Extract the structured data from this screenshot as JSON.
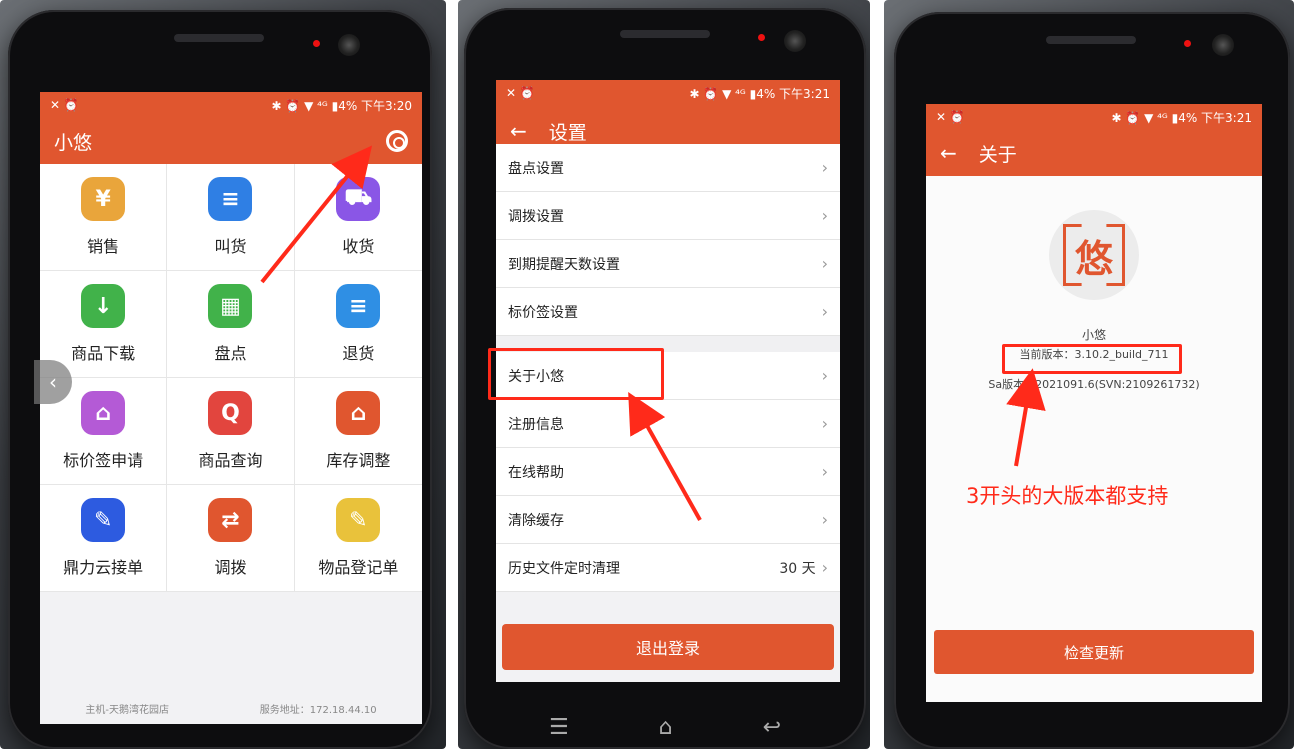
{
  "colors": {
    "accent": "#e0562f",
    "annotation": "#ff2a1a"
  },
  "panel1": {
    "status": {
      "left_icons": "✕ ⏰",
      "right": "✱ ⏰ ▼ ⁴ᴳ ▮4% 下午3:20"
    },
    "app_title": "小悠",
    "settings_icon": "gear-icon",
    "grid": [
      {
        "label": "销售",
        "icon": "sales-icon",
        "color": "#e9a53b",
        "glyph": "¥"
      },
      {
        "label": "叫货",
        "icon": "order-icon",
        "color": "#2f7fe4",
        "glyph": "≡"
      },
      {
        "label": "收货",
        "icon": "receive-truck-icon",
        "color": "#8a56e6",
        "glyph": "⛟"
      },
      {
        "label": "商品下载",
        "icon": "download-icon",
        "color": "#41b24a",
        "glyph": "↓"
      },
      {
        "label": "盘点",
        "icon": "calculator-icon",
        "color": "#41b24a",
        "glyph": "▦"
      },
      {
        "label": "退货",
        "icon": "return-icon",
        "color": "#2f8fe4",
        "glyph": "≡"
      },
      {
        "label": "标价签申请",
        "icon": "price-tag-icon",
        "color": "#b45ad6",
        "glyph": "⌂"
      },
      {
        "label": "商品查询",
        "icon": "search-icon",
        "color": "#e2453e",
        "glyph": "Q"
      },
      {
        "label": "库存调整",
        "icon": "warehouse-icon",
        "color": "#e0562f",
        "glyph": "⌂"
      },
      {
        "label": "鼎力云接单",
        "icon": "cloud-order-icon",
        "color": "#2d5be0",
        "glyph": "✎"
      },
      {
        "label": "调拨",
        "icon": "transfer-icon",
        "color": "#e0562f",
        "glyph": "⇄"
      },
      {
        "label": "物品登记单",
        "icon": "register-icon",
        "color": "#e9c23b",
        "glyph": "✎"
      }
    ],
    "footer_left": "主机-天鹅湾花园店",
    "footer_right": "服务地址：172.18.44.10"
  },
  "panel2": {
    "status": {
      "left_icons": "✕ ⏰",
      "right": "✱ ⏰ ▼ ⁴ᴳ ▮4% 下午3:21"
    },
    "title": "设置",
    "rows_top": [
      "盘点设置",
      "调拨设置",
      "到期提醒天数设置",
      "标价签设置"
    ],
    "rows_bottom": [
      "关于小悠",
      "注册信息",
      "在线帮助",
      "清除缓存"
    ],
    "history_row": {
      "label": "历史文件定时清理",
      "value": "30 天"
    },
    "logout": "退出登录"
  },
  "panel3": {
    "status": {
      "left_icons": "✕ ⏰",
      "right": "✱ ⏰ ▼ ⁴ᴳ ▮4% 下午3:21"
    },
    "title": "关于",
    "logo_char": "悠",
    "app_name": "小悠",
    "version": "当前版本：3.10.2_build_711",
    "sa_version": "Sa版本：2021091.6(SVN:2109261732)",
    "check_update": "检查更新",
    "annotation": "3开头的大版本都支持"
  }
}
